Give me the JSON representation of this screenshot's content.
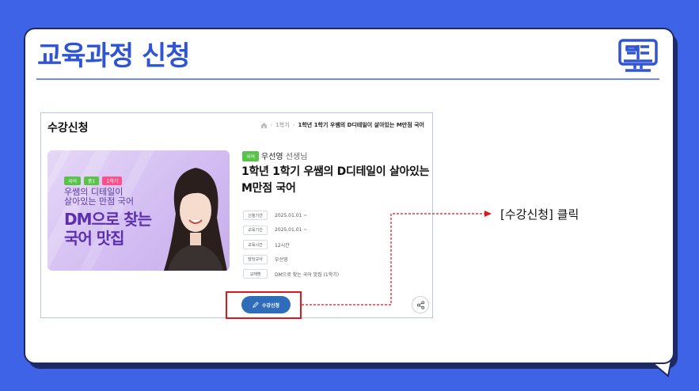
{
  "slide": {
    "title": "교육과정 신청",
    "book_icon": "book-monitor-icon",
    "callout": "[수강신청] 클릭"
  },
  "panel": {
    "title": "수강신청",
    "breadcrumb": {
      "level1": "1학기",
      "current": "1학년 1학기 우쌤의 D디테일이 살아있는 M만점 국어"
    }
  },
  "thumbnail": {
    "tags": [
      "국어",
      "중1",
      "1학기"
    ],
    "line1": "우쌤의 디테일이",
    "line2": "살아있는 만점 국어",
    "big1": "DM으로 찾는",
    "big2": "국어 맛집"
  },
  "course": {
    "subject": "국어",
    "teacher": "우선영",
    "teacher_suffix": "선생님",
    "title": "1학년 1학기 우쌤의 D디테일이 살아있는 M만점 국어",
    "info": [
      {
        "label": "신청기간",
        "value": "2025.01.01 ~"
      },
      {
        "label": "교육기간",
        "value": "2025.01.01 ~"
      },
      {
        "label": "교육시간",
        "value": "12시간"
      },
      {
        "label": "담당교사",
        "value": "우선영"
      },
      {
        "label": "교재명",
        "value": "DM으로 찾는 국어 맛집 (1학기)"
      }
    ],
    "apply_label": "수강신청"
  },
  "colors": {
    "background": "#3f63e6",
    "title": "#2f55d4",
    "apply_button": "#2f6dbb",
    "highlight": "#e2141c",
    "subject_badge": "#59c24a"
  }
}
